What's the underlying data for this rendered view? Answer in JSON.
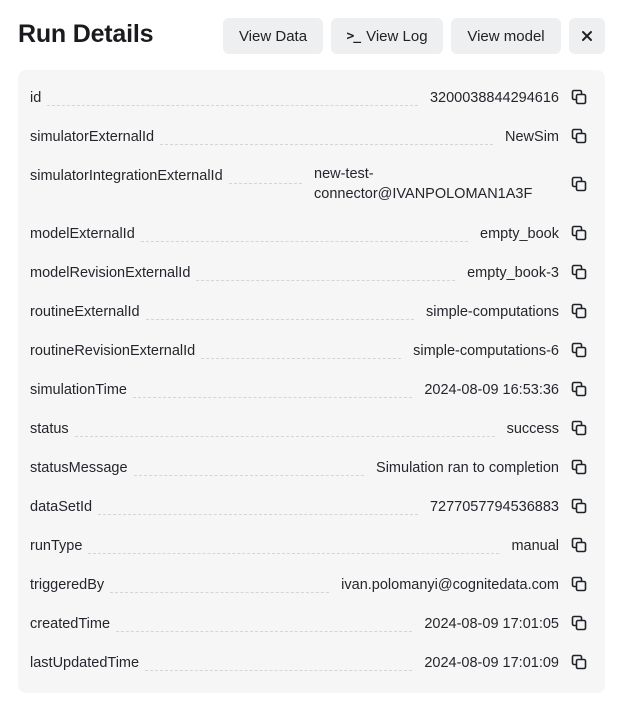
{
  "header": {
    "title": "Run Details",
    "view_data_label": "View Data",
    "view_log_label": "View Log",
    "view_log_icon": "terminal-icon",
    "view_model_label": "View model",
    "close_icon": "close-icon"
  },
  "colors": {
    "button_bg": "#eeeff1",
    "card_bg": "#f6f6f7",
    "text": "#24262b",
    "title": "#1b1b1f",
    "leader": "#d3d5da"
  },
  "details": {
    "rows": [
      {
        "key": "id",
        "value": "3200038844294616"
      },
      {
        "key": "simulatorExternalId",
        "value": "NewSim"
      },
      {
        "key": "simulatorIntegrationExternalId",
        "value": "new-test-connector@IVANPOLOMAN1A3F"
      },
      {
        "key": "modelExternalId",
        "value": "empty_book"
      },
      {
        "key": "modelRevisionExternalId",
        "value": "empty_book-3"
      },
      {
        "key": "routineExternalId",
        "value": "simple-computations"
      },
      {
        "key": "routineRevisionExternalId",
        "value": "simple-computations-6"
      },
      {
        "key": "simulationTime",
        "value": "2024-08-09 16:53:36"
      },
      {
        "key": "status",
        "value": "success"
      },
      {
        "key": "statusMessage",
        "value": "Simulation ran to completion"
      },
      {
        "key": "dataSetId",
        "value": "7277057794536883"
      },
      {
        "key": "runType",
        "value": "manual"
      },
      {
        "key": "triggeredBy",
        "value": "ivan.polomanyi@cognitedata.com"
      },
      {
        "key": "createdTime",
        "value": "2024-08-09 17:01:05"
      },
      {
        "key": "lastUpdatedTime",
        "value": "2024-08-09 17:01:09"
      }
    ],
    "copy_icon": "copy-icon"
  }
}
